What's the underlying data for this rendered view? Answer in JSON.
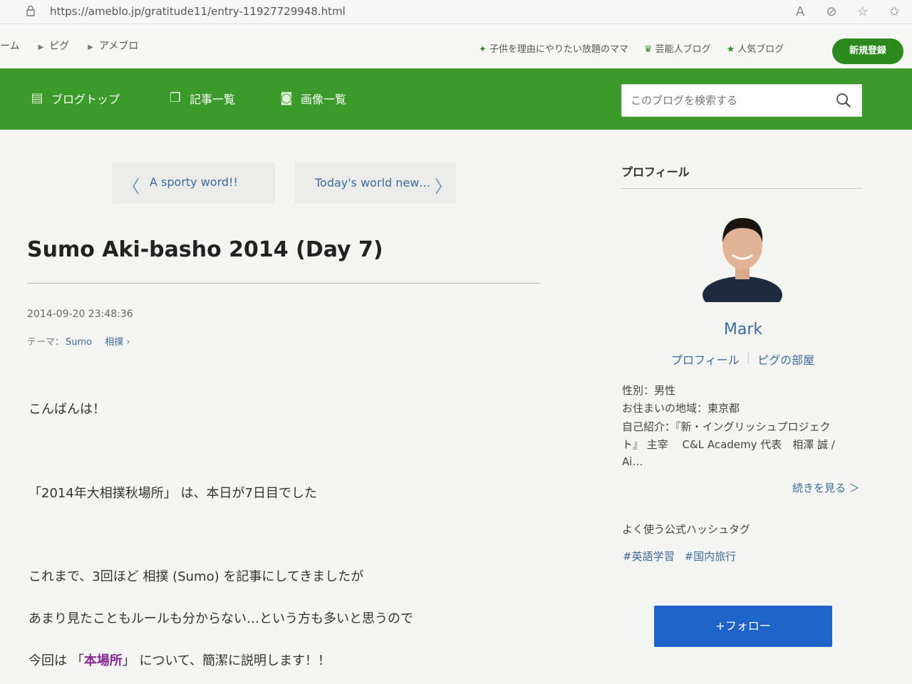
{
  "browser": {
    "url": "https://ameblo.jp/gratitude11/entry-11927729948.html",
    "icons": [
      "read-aloud-icon",
      "extension-icon",
      "favorite-add-icon",
      "favorites-icon"
    ]
  },
  "header": {
    "crumbs": [
      "ーム",
      "ピグ",
      "アメブロ"
    ],
    "links": [
      "子供を理由にやりたい放題のママ",
      "芸能人ブログ",
      "人気ブログ"
    ],
    "signup_label": "新規登録"
  },
  "nav": {
    "items": [
      {
        "label": "ブログトップ",
        "icon": "list-icon"
      },
      {
        "label": "記事一覧",
        "icon": "copy-icon"
      },
      {
        "label": "画像一覧",
        "icon": "camera-icon"
      }
    ],
    "search_placeholder": "このブログを検索する"
  },
  "article": {
    "prev_title": "A sporty word!!",
    "next_title": "Today's world new…",
    "title": "Sumo Aki-basho 2014 (Day 7)",
    "date": "2014-09-20 23:48:36",
    "theme_label": "テーマ：",
    "theme_values": [
      "Sumo",
      "相撲"
    ],
    "lines": [
      "こんばんは！",
      "「2014年大相撲秋場所」 は、本日が7日目でした",
      "これまで、3回ほど 相撲 (Sumo) を記事にしてきましたが",
      "あまり見たこともルールも分からない…という方も多いと思うので",
      "今回は 「",
      "本場所",
      "」 について、簡潔に説明します！！"
    ]
  },
  "sidebar": {
    "title": "プロフィール",
    "name": "Mark",
    "links": [
      "プロフィール",
      "ピグの部屋"
    ],
    "gender": "性別：男性",
    "location": "お住まいの地域：東京都",
    "intro_line1": "自己紹介：『新・イングリッシュプロジェク",
    "intro_line2": "ト』 主宰　 C&L Academy 代表　相澤 誠 /",
    "intro_line3": "Ai…",
    "more": "続きを見る ＞",
    "hashtag_title": "よく使う公式ハッシュタグ",
    "hashtags": [
      "#英語学習",
      "#国内旅行"
    ],
    "follow_label": "+フォロー"
  }
}
